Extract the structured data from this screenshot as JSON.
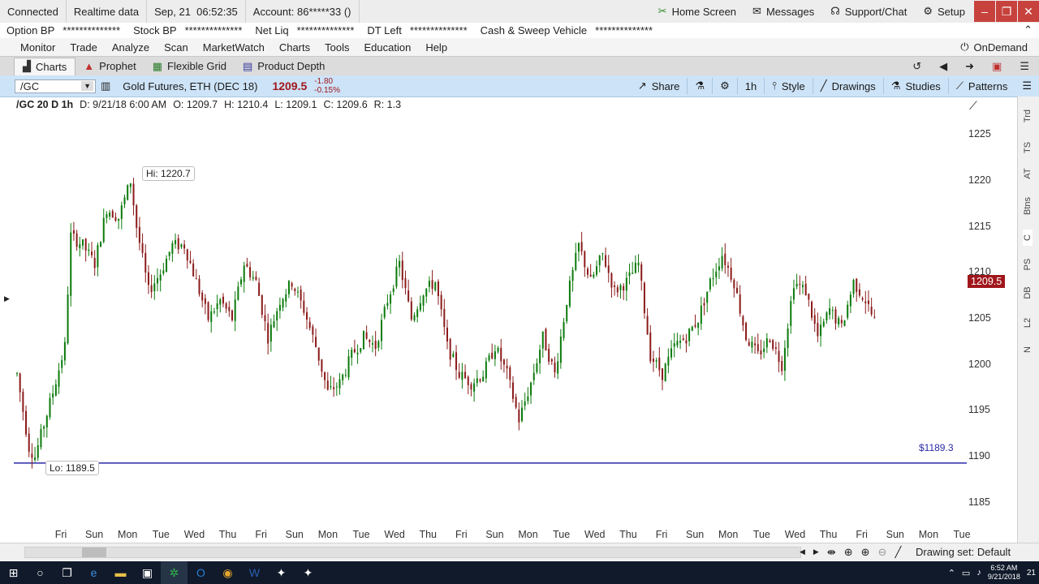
{
  "status": {
    "connection": "Connected",
    "data_mode": "Realtime data",
    "date": "Sep, 21",
    "time": "06:52:35",
    "account_label": "Account:",
    "account_value": "86*****33 ()",
    "home_screen": "Home Screen",
    "messages": "Messages",
    "support": "Support/Chat",
    "setup": "Setup"
  },
  "balances": [
    {
      "label": "Option BP",
      "value": "**************"
    },
    {
      "label": "Stock BP",
      "value": "**************"
    },
    {
      "label": "Net Liq",
      "value": "**************"
    },
    {
      "label": "DT Left",
      "value": "**************"
    },
    {
      "label": "Cash & Sweep Vehicle",
      "value": "**************"
    }
  ],
  "menu": [
    "Monitor",
    "Trade",
    "Analyze",
    "Scan",
    "MarketWatch",
    "Charts",
    "Tools",
    "Education",
    "Help"
  ],
  "ondemand": "OnDemand",
  "tabs": [
    "Charts",
    "Prophet",
    "Flexible Grid",
    "Product Depth"
  ],
  "toolbar": {
    "symbol": "/GC",
    "description": "Gold Futures, ETH (DEC 18)",
    "last": "1209.5",
    "change": "-1.80",
    "change_pct": "-0.15%",
    "share": "Share",
    "timeframe": "1h",
    "style": "Style",
    "drawings": "Drawings",
    "studies": "Studies",
    "patterns": "Patterns"
  },
  "info": {
    "title": "/GC 20 D 1h",
    "date": "D: 9/21/18 6:00 AM",
    "open": "O: 1209.7",
    "high": "H: 1210.4",
    "low": "L: 1209.1",
    "close": "C: 1209.6",
    "range": "R: 1.3"
  },
  "annotations": {
    "hi": "Hi: 1220.7",
    "lo": "Lo: 1189.5",
    "price_line": "$1189.3",
    "last_price": "1209.5"
  },
  "right_tabs": [
    "Trd",
    "TS",
    "AT",
    "Btns",
    "C",
    "PS",
    "DB",
    "L2",
    "N"
  ],
  "bottom": {
    "drawing_set": "Drawing set: Default"
  },
  "taskbar": {
    "time": "6:52 AM",
    "date": "9/21/2018",
    "notif": "21"
  },
  "colors": {
    "up": "#0a7a0a",
    "down": "#8b1a1a",
    "price_line": "#2a2aa8",
    "last_box": "#a0171b",
    "toolbar_bg": "#cde3f7",
    "taskbar_bg": "#101a2a"
  },
  "chart_data": {
    "type": "candlestick",
    "symbol": "/GC",
    "interval": "1h",
    "ylim": [
      1182.5,
      1227.5
    ],
    "y_ticks": [
      1225,
      1220,
      1215,
      1210,
      1205,
      1200,
      1195,
      1190,
      1185
    ],
    "x_ticks": [
      "Fri",
      "Sun",
      "Mon",
      "Tue",
      "Wed",
      "Thu",
      "Fri",
      "Sun",
      "Mon",
      "Tue",
      "Wed",
      "Thu",
      "Fri",
      "Sun",
      "Mon",
      "Tue",
      "Wed",
      "Thu",
      "Fri",
      "Sun",
      "Mon",
      "Tue",
      "Wed",
      "Thu",
      "Fri",
      "Sun",
      "Mon",
      "Tue"
    ],
    "high": 1220.7,
    "low": 1189.5,
    "horizontal_line": 1189.3,
    "last": 1209.5,
    "path": [
      [
        0,
        1199
      ],
      [
        2,
        1191
      ],
      [
        3,
        1190
      ],
      [
        6,
        1197
      ],
      [
        8,
        1202
      ],
      [
        9,
        1214
      ],
      [
        11,
        1213
      ],
      [
        13,
        1211
      ],
      [
        15,
        1217
      ],
      [
        17,
        1216
      ],
      [
        19,
        1220
      ],
      [
        20,
        1215
      ],
      [
        22,
        1208
      ],
      [
        24,
        1210
      ],
      [
        26,
        1213
      ],
      [
        28,
        1213
      ],
      [
        30,
        1209
      ],
      [
        32,
        1205
      ],
      [
        34,
        1207
      ],
      [
        36,
        1205
      ],
      [
        38,
        1211
      ],
      [
        40,
        1209
      ],
      [
        42,
        1203
      ],
      [
        44,
        1207
      ],
      [
        46,
        1209
      ],
      [
        48,
        1206
      ],
      [
        50,
        1202
      ],
      [
        52,
        1197
      ],
      [
        54,
        1198
      ],
      [
        56,
        1201
      ],
      [
        58,
        1203
      ],
      [
        60,
        1202
      ],
      [
        62,
        1207
      ],
      [
        64,
        1211
      ],
      [
        66,
        1205
      ],
      [
        68,
        1208
      ],
      [
        70,
        1209
      ],
      [
        72,
        1202
      ],
      [
        74,
        1199
      ],
      [
        76,
        1198
      ],
      [
        78,
        1199
      ],
      [
        80,
        1202
      ],
      [
        82,
        1199
      ],
      [
        84,
        1194
      ],
      [
        86,
        1198
      ],
      [
        88,
        1203
      ],
      [
        90,
        1199
      ],
      [
        92,
        1207
      ],
      [
        94,
        1213
      ],
      [
        96,
        1209
      ],
      [
        98,
        1212
      ],
      [
        100,
        1208
      ],
      [
        102,
        1209
      ],
      [
        104,
        1211
      ],
      [
        106,
        1201
      ],
      [
        108,
        1199
      ],
      [
        110,
        1202
      ],
      [
        112,
        1203
      ],
      [
        114,
        1205
      ],
      [
        116,
        1209
      ],
      [
        118,
        1212
      ],
      [
        120,
        1209
      ],
      [
        122,
        1203
      ],
      [
        124,
        1201
      ],
      [
        126,
        1203
      ],
      [
        128,
        1200
      ],
      [
        130,
        1209
      ],
      [
        132,
        1208
      ],
      [
        134,
        1203
      ],
      [
        136,
        1206
      ],
      [
        138,
        1204
      ],
      [
        140,
        1209
      ],
      [
        142,
        1207
      ],
      [
        144,
        1204
      ]
    ]
  }
}
